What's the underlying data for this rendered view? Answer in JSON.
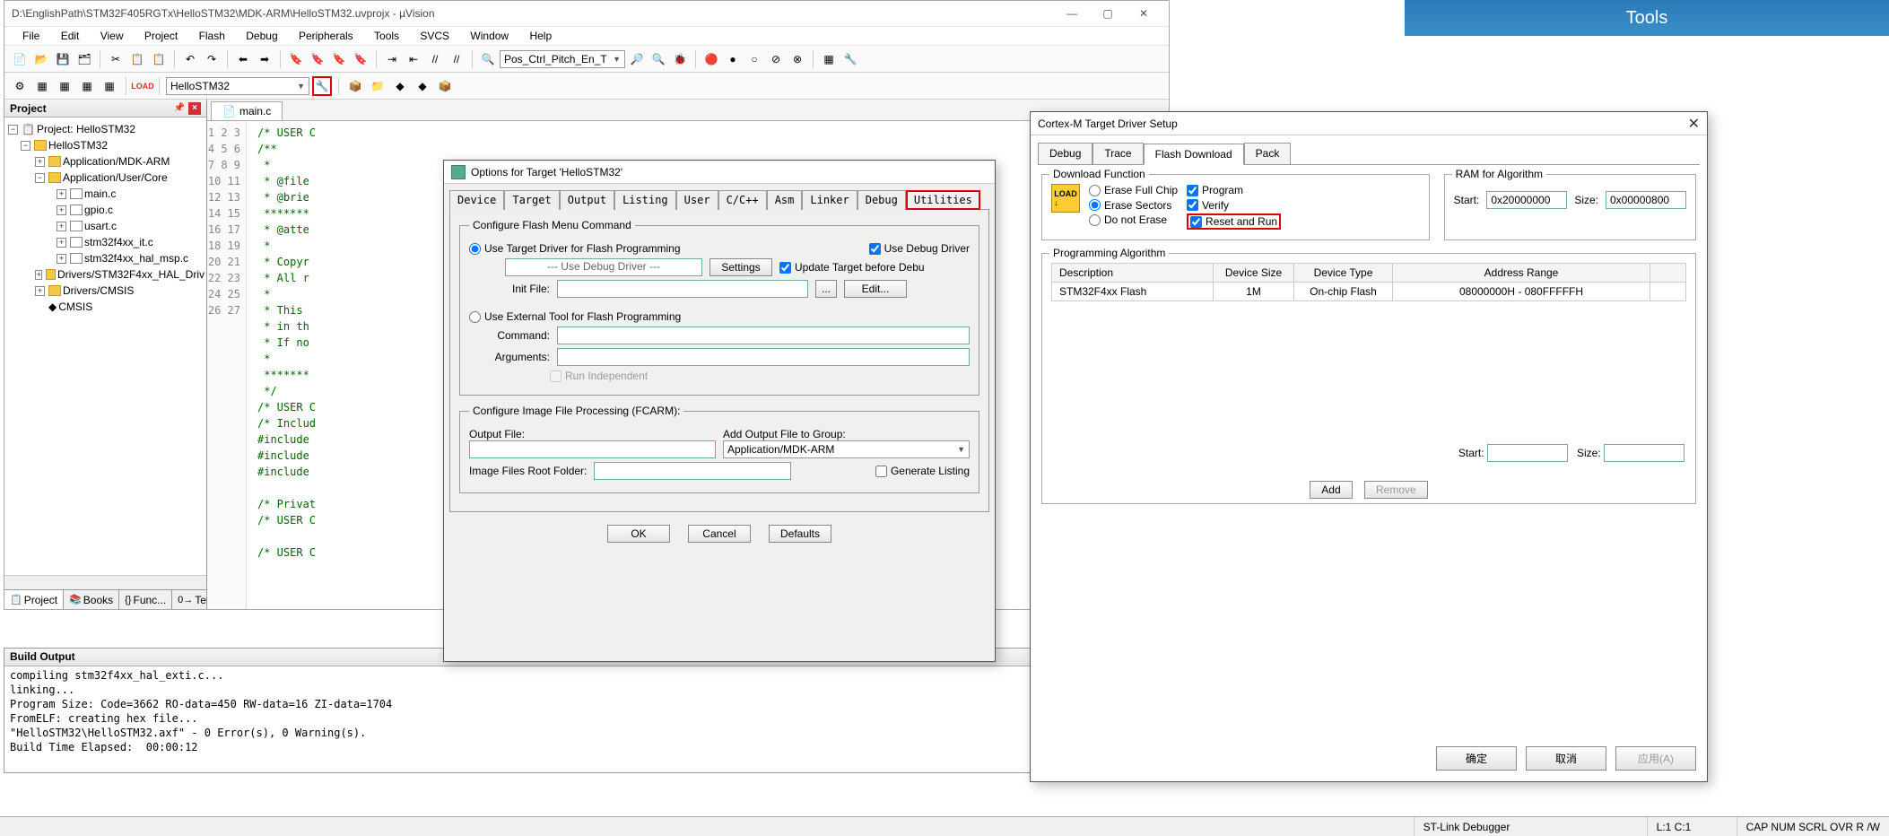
{
  "bluePanel": "Tools",
  "title": "D:\\EnglishPath\\STM32F405RGTx\\HelloSTM32\\MDK-ARM\\HelloSTM32.uvprojx - µVision",
  "menu": [
    "File",
    "Edit",
    "View",
    "Project",
    "Flash",
    "Debug",
    "Peripherals",
    "Tools",
    "SVCS",
    "Window",
    "Help"
  ],
  "combo1": "Pos_Ctrl_Pitch_En_T",
  "targetCombo": "HelloSTM32",
  "projectHeader": "Project",
  "tree": {
    "root": "Project: HelloSTM32",
    "a": "HelloSTM32",
    "b": "Application/MDK-ARM",
    "c": "Application/User/Core",
    "files": [
      "main.c",
      "gpio.c",
      "usart.c",
      "stm32f4xx_it.c",
      "stm32f4xx_hal_msp.c"
    ],
    "d": "Drivers/STM32F4xx_HAL_Driv",
    "e": "Drivers/CMSIS",
    "f": "CMSIS"
  },
  "treeTabs": [
    "Project",
    "Books",
    "Func...",
    "Temp..."
  ],
  "fileTab": "main.c",
  "code": {
    "lines": [
      "/* USER C",
      "/**",
      " *",
      " * @file",
      " * @brie",
      " *******",
      " * @atte",
      " *",
      " * Copyr",
      " * All r",
      " *",
      " * This",
      " * in th",
      " * If no",
      " *",
      " *******",
      " */",
      "/* USER C",
      "/* Includ",
      "#include",
      "#include",
      "#include",
      "",
      "/* Privat",
      "/* USER C",
      "",
      "/* USER C"
    ]
  },
  "buildHeader": "Build Output",
  "build": "compiling stm32f4xx_hal_exti.c...\nlinking...\nProgram Size: Code=3662 RO-data=450 RW-data=16 ZI-data=1704\nFromELF: creating hex file...\n\"HelloSTM32\\HelloSTM32.axf\" - 0 Error(s), 0 Warning(s).\nBuild Time Elapsed:  00:00:12",
  "status": {
    "debugger": "ST-Link Debugger",
    "pos": "L:1 C:1",
    "caps": "CAP NUM SCRL OVR R /W"
  },
  "opt": {
    "title": "Options for Target 'HelloSTM32'",
    "tabs": [
      "Device",
      "Target",
      "Output",
      "Listing",
      "User",
      "C/C++",
      "Asm",
      "Linker",
      "Debug",
      "Utilities"
    ],
    "g1": "Configure Flash Menu Command",
    "r1": "Use Target Driver for Flash Programming",
    "useDbg": "Use Debug Driver",
    "drv": "--- Use Debug Driver ---",
    "settings": "Settings",
    "upd": "Update Target before Debu",
    "initLbl": "Init File:",
    "edit": "Edit...",
    "r2": "Use External Tool for Flash Programming",
    "cmdLbl": "Command:",
    "argLbl": "Arguments:",
    "runInd": "Run Independent",
    "g2": "Configure Image File Processing (FCARM):",
    "outLbl": "Output File:",
    "addLbl": "Add Output File  to Group:",
    "addVal": "Application/MDK-ARM",
    "rootLbl": "Image Files Root Folder:",
    "gen": "Generate Listing",
    "ok": "OK",
    "cancel": "Cancel",
    "def": "Defaults"
  },
  "cx": {
    "title": "Cortex-M Target Driver Setup",
    "tabs": [
      "Debug",
      "Trace",
      "Flash Download",
      "Pack"
    ],
    "g1": "Download Function",
    "eraseFull": "Erase Full Chip",
    "eraseSec": "Erase Sectors",
    "noErase": "Do not Erase",
    "prog": "Program",
    "verify": "Verify",
    "reset": "Reset and Run",
    "g2": "RAM for Algorithm",
    "startLbl": "Start:",
    "startVal": "0x20000000",
    "sizeLbl": "Size:",
    "sizeVal": "0x00000800",
    "g3": "Programming Algorithm",
    "th": [
      "Description",
      "Device Size",
      "Device Type",
      "Address Range"
    ],
    "row": [
      "STM32F4xx Flash",
      "1M",
      "On-chip Flash",
      "08000000H - 080FFFFFH"
    ],
    "start2": "Start:",
    "size2": "Size:",
    "add": "Add",
    "remove": "Remove",
    "ok": "确定",
    "cancel": "取消",
    "apply": "应用(A)"
  }
}
